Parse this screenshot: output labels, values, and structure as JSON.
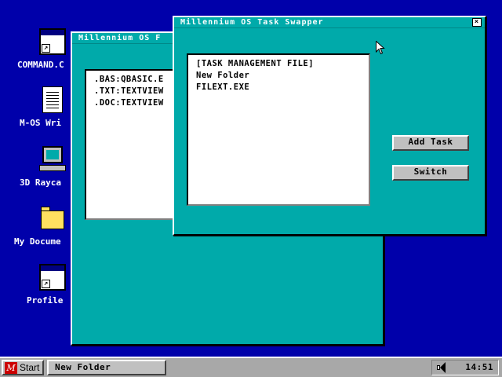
{
  "desktop": {
    "background_color": "#0000AA",
    "icons": [
      {
        "label": "COMMAND.C",
        "icon": "app-shortcut-icon"
      },
      {
        "label": "M-OS Wri",
        "icon": "document-icon"
      },
      {
        "label": "3D Rayca",
        "icon": "computer-icon"
      },
      {
        "label": "My Docume",
        "icon": "folder-icon"
      },
      {
        "label": "Profile",
        "icon": "app-shortcut-icon"
      }
    ]
  },
  "back_window": {
    "title": "Millennium OS F",
    "list": [
      ".BAS:QBASIC.E",
      ".TXT:TEXTVIEW",
      ".DOC:TEXTVIEW"
    ]
  },
  "front_window": {
    "title": "Millennium OS Task Swapper",
    "close_glyph": "×",
    "list": [
      "[TASK MANAGEMENT FILE]",
      "New Folder",
      "FILEXT.EXE"
    ],
    "add_task_label": "Add Task",
    "switch_label": "Switch"
  },
  "taskbar": {
    "start_logo": "M",
    "start_label": "Start",
    "task_label": "New Folder",
    "clock": "14:51"
  },
  "colors": {
    "window_face": "#00AAAA",
    "button_face": "#C0C0C0",
    "taskbar": "#A8A8A8"
  }
}
